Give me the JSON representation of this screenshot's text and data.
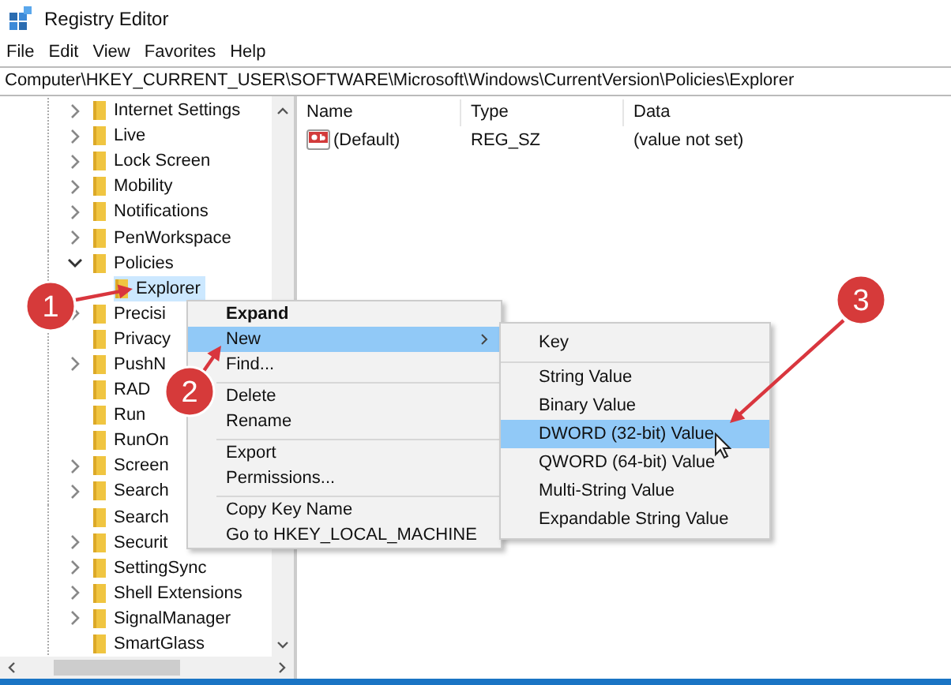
{
  "window": {
    "title": "Registry Editor"
  },
  "menu_bar": [
    "File",
    "Edit",
    "View",
    "Favorites",
    "Help"
  ],
  "address": "Computer\\HKEY_CURRENT_USER\\SOFTWARE\\Microsoft\\Windows\\CurrentVersion\\Policies\\Explorer",
  "tree": [
    {
      "label": "Internet Settings",
      "has_children": true,
      "expanded": false,
      "selected": false
    },
    {
      "label": "Live",
      "has_children": true,
      "expanded": false,
      "selected": false
    },
    {
      "label": "Lock Screen",
      "has_children": true,
      "expanded": false,
      "selected": false
    },
    {
      "label": "Mobility",
      "has_children": true,
      "expanded": false,
      "selected": false
    },
    {
      "label": "Notifications",
      "has_children": true,
      "expanded": false,
      "selected": false
    },
    {
      "label": "PenWorkspace",
      "has_children": true,
      "expanded": false,
      "selected": false
    },
    {
      "label": "Policies",
      "has_children": true,
      "expanded": true,
      "selected": false,
      "children": [
        {
          "label": "Explorer",
          "has_children": false,
          "selected": true
        }
      ]
    },
    {
      "label": "Precisi",
      "has_children": true,
      "expanded": false,
      "selected": false
    },
    {
      "label": "Privacy",
      "has_children": false,
      "selected": false
    },
    {
      "label": "PushN",
      "has_children": true,
      "expanded": false,
      "selected": false
    },
    {
      "label": "RAD",
      "has_children": false,
      "selected": false
    },
    {
      "label": "Run",
      "has_children": false,
      "selected": false
    },
    {
      "label": "RunOn",
      "has_children": false,
      "selected": false
    },
    {
      "label": "Screen",
      "has_children": true,
      "expanded": false,
      "selected": false
    },
    {
      "label": "Search",
      "has_children": true,
      "expanded": false,
      "selected": false
    },
    {
      "label": "Search",
      "has_children": false,
      "selected": false
    },
    {
      "label": "Securit",
      "has_children": true,
      "expanded": false,
      "selected": false
    },
    {
      "label": "SettingSync",
      "has_children": true,
      "expanded": false,
      "selected": false
    },
    {
      "label": "Shell Extensions",
      "has_children": true,
      "expanded": false,
      "selected": false
    },
    {
      "label": "SignalManager",
      "has_children": true,
      "expanded": false,
      "selected": false
    },
    {
      "label": "SmartGlass",
      "has_children": false,
      "selected": false
    }
  ],
  "table": {
    "columns": [
      "Name",
      "Type",
      "Data"
    ],
    "rows": [
      {
        "name": "(Default)",
        "type": "REG_SZ",
        "data": "(value not set)"
      }
    ]
  },
  "context_menu": [
    {
      "label": "Expand",
      "default": true,
      "selected": false,
      "submenu": false,
      "separator_before": false
    },
    {
      "label": "New",
      "default": false,
      "selected": true,
      "submenu": true,
      "separator_before": false
    },
    {
      "label": "Find...",
      "default": false,
      "selected": false,
      "submenu": false,
      "separator_before": false
    },
    {
      "label": "Delete",
      "default": false,
      "selected": false,
      "submenu": false,
      "separator_before": true
    },
    {
      "label": "Rename",
      "default": false,
      "selected": false,
      "submenu": false,
      "separator_before": false
    },
    {
      "label": "Export",
      "default": false,
      "selected": false,
      "submenu": false,
      "separator_before": true
    },
    {
      "label": "Permissions...",
      "default": false,
      "selected": false,
      "submenu": false,
      "separator_before": false
    },
    {
      "label": "Copy Key Name",
      "default": false,
      "selected": false,
      "submenu": false,
      "separator_before": true
    },
    {
      "label": "Go to HKEY_LOCAL_MACHINE",
      "default": false,
      "selected": false,
      "submenu": false,
      "separator_before": false
    }
  ],
  "submenu": [
    {
      "label": "Key",
      "selected": false,
      "separator_before": false
    },
    {
      "label": "String Value",
      "selected": false,
      "separator_before": true
    },
    {
      "label": "Binary Value",
      "selected": false,
      "separator_before": false
    },
    {
      "label": "DWORD (32-bit) Value",
      "selected": true,
      "separator_before": false
    },
    {
      "label": "QWORD (64-bit) Value",
      "selected": false,
      "separator_before": false
    },
    {
      "label": "Multi-String Value",
      "selected": false,
      "separator_before": false
    },
    {
      "label": "Expandable String Value",
      "selected": false,
      "separator_before": false
    }
  ],
  "annotations": [
    {
      "number": "1"
    },
    {
      "number": "2"
    },
    {
      "number": "3"
    }
  ]
}
